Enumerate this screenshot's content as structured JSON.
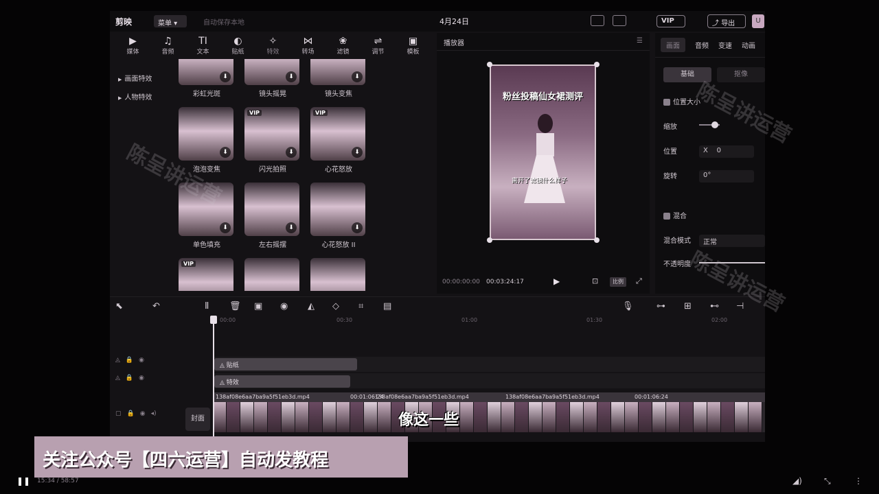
{
  "app": {
    "logo": "剪映",
    "menu_label": "菜单",
    "autosave_text": "自动保存本地 ",
    "project_title": "4月24日",
    "vip_label": "VIP",
    "export_label": "导出",
    "avatar_letter": "U"
  },
  "tool_tabs": [
    {
      "icon": "▶",
      "label": "媒体"
    },
    {
      "icon": "♫",
      "label": "音频"
    },
    {
      "icon": "TI",
      "label": "文本"
    },
    {
      "icon": "◐",
      "label": "贴纸"
    },
    {
      "icon": "✧",
      "label": "特效"
    },
    {
      "icon": "⋈",
      "label": "转场"
    },
    {
      "icon": "❀",
      "label": "滤镜"
    },
    {
      "icon": "⇌",
      "label": "调节"
    },
    {
      "icon": "▣",
      "label": "模板"
    }
  ],
  "categories": [
    "画面特效",
    "人物特效"
  ],
  "effects": [
    {
      "label": "彩虹光斑",
      "vip": false
    },
    {
      "label": "镜头摇晃",
      "vip": false
    },
    {
      "label": "镜头变焦",
      "vip": false
    },
    {
      "label": "泡泡变焦",
      "vip": false
    },
    {
      "label": "闪光拍照",
      "vip": true
    },
    {
      "label": "心花怒放",
      "vip": true
    },
    {
      "label": "单色填充",
      "vip": false
    },
    {
      "label": "左右摇摆",
      "vip": false
    },
    {
      "label": "心花怒放 II",
      "vip": false
    },
    {
      "label": "",
      "vip": true
    },
    {
      "label": "",
      "vip": false
    },
    {
      "label": "",
      "vip": false
    }
  ],
  "player": {
    "header": "播放器",
    "video_title": "粉丝投稿仙女裙测评",
    "video_subtitle": "离开了滤镜什么样子",
    "current_time": "00:00:00:00",
    "total_time": "00:03:24:17",
    "ratio_label": "比例"
  },
  "properties": {
    "tabs": [
      "画面",
      "音频",
      "变速",
      "动画"
    ],
    "sub_tabs": [
      "基础",
      "抠像"
    ],
    "position_size_label": "位置大小",
    "scale_label": "缩放",
    "position_label": "位置",
    "position_x_prefix": "X",
    "position_x": "0",
    "rotate_label": "旋转",
    "rotate_value": "0°",
    "blend_label": "混合",
    "blend_mode_label": "混合模式",
    "blend_mode_value": "正常",
    "opacity_label": "不透明度"
  },
  "timeline": {
    "ruler": [
      "00:00",
      "00:30",
      "01:00",
      "01:30",
      "02:00"
    ],
    "sticker_clip": "贴纸",
    "effect_clip": "特效",
    "cover_label": "封面",
    "main_clip_name": "138af08e6aa7ba9a5f51eb3d.mp4",
    "main_clip_duration": "00:01:06:24",
    "overlay_subtitle": "像这一些"
  },
  "watermark_text": "陈呈讲运营",
  "banner_text": "关注公众号【四六运营】自动发教程",
  "video_player": {
    "time": "15:34 / 58:57"
  }
}
